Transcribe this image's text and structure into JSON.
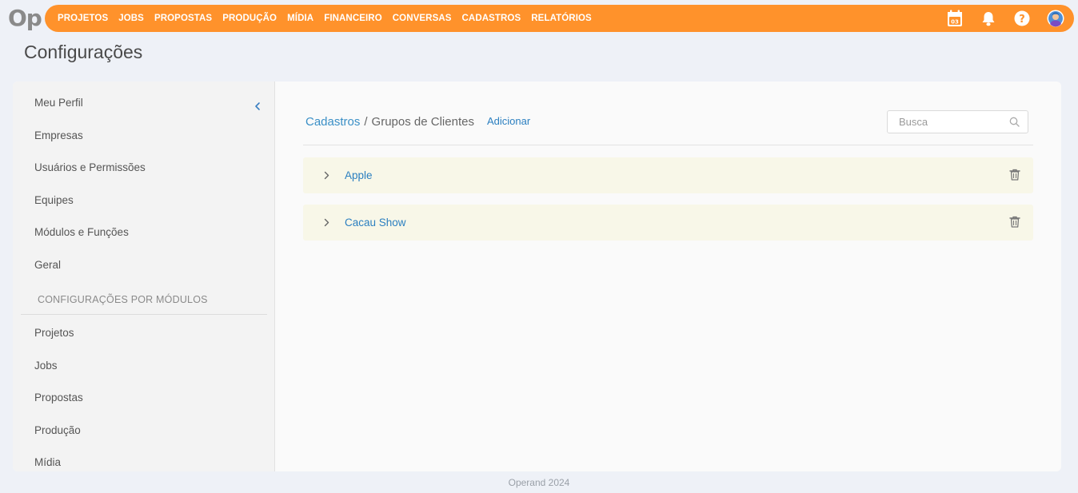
{
  "logo": "Op",
  "nav": [
    "PROJETOS",
    "JOBS",
    "PROPOSTAS",
    "PRODUÇÃO",
    "MÍDIA",
    "FINANCEIRO",
    "CONVERSAS",
    "CADASTROS",
    "RELATÓRIOS"
  ],
  "top_icons": {
    "calendar_day": "03",
    "icons": [
      "calendar-icon",
      "bell-icon",
      "help-icon",
      "user-avatar"
    ]
  },
  "page_title": "Configurações",
  "sidebar": {
    "items": [
      "Meu Perfil",
      "Empresas",
      "Usuários e Permissões",
      "Equipes",
      "Módulos e Funções",
      "Geral"
    ],
    "section_title": "CONFIGURAÇÕES POR MÓDULOS",
    "module_items": [
      "Projetos",
      "Jobs",
      "Propostas",
      "Produção",
      "Mídia"
    ]
  },
  "content": {
    "breadcrumb_link": "Cadastros",
    "breadcrumb_sep": "/",
    "breadcrumb_current": "Grupos de Clientes",
    "add_label": "Adicionar",
    "search_placeholder": "Busca",
    "groups": [
      "Apple",
      "Cacau Show"
    ]
  },
  "footer": "Operand 2024",
  "colors": {
    "accent": "#ff922b",
    "link": "#2b7fc0",
    "row_bg": "#f8f7e8"
  }
}
